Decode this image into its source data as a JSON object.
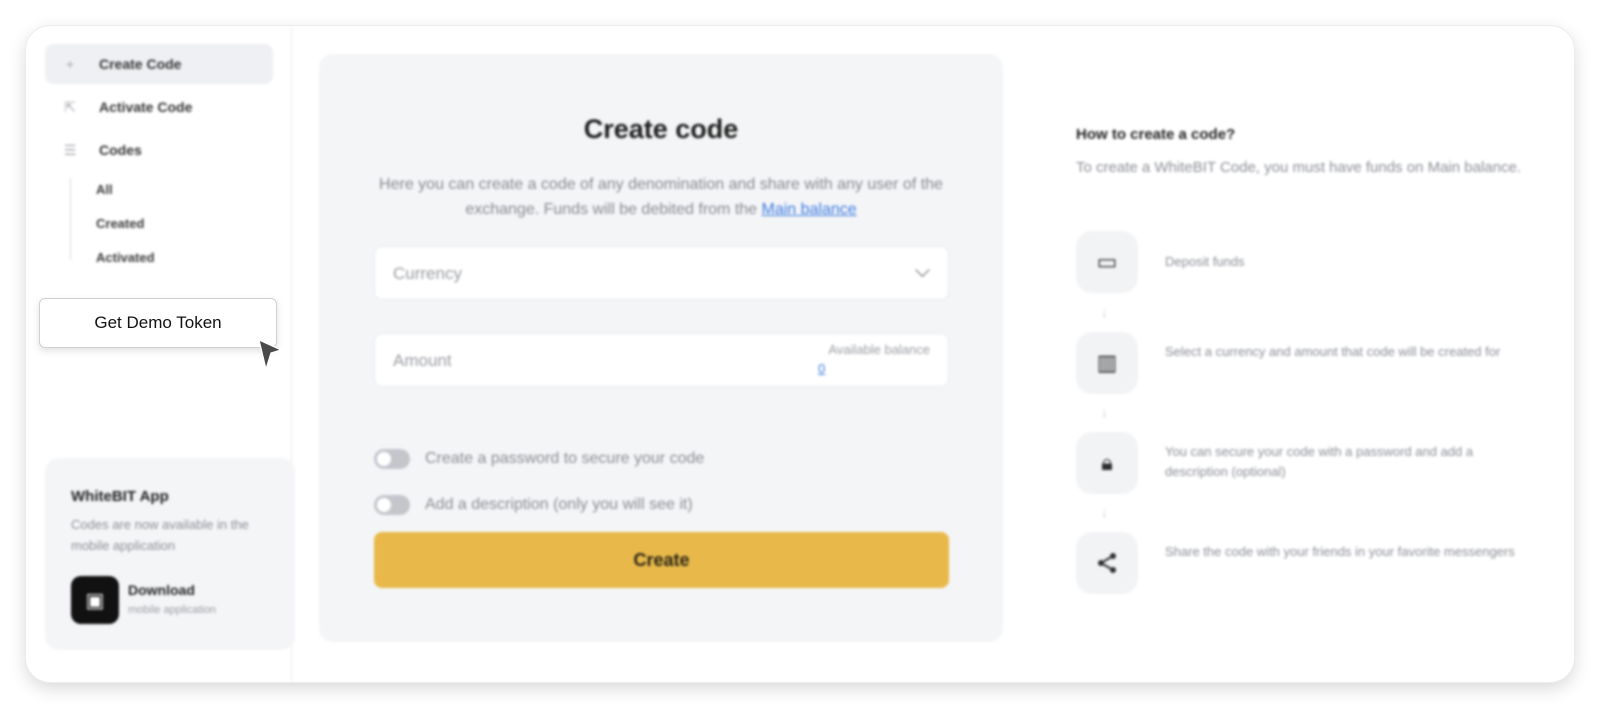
{
  "sidebar": {
    "items": [
      {
        "icon": "plus-icon",
        "label": "Create Code",
        "active": true
      },
      {
        "icon": "activate-icon",
        "label": "Activate Code"
      },
      {
        "icon": "list-icon",
        "label": "Codes"
      }
    ],
    "subitems": [
      "All",
      "Created",
      "Activated"
    ],
    "app_card": {
      "title": "WhiteBIT App",
      "desc": "Codes are now available in the mobile application",
      "download": "Download",
      "download_sub": "mobile application"
    }
  },
  "form": {
    "title": "Create code",
    "desc_part1": "Here you can create a code of any denomination and share with any user of the exchange. Funds will be debited from the ",
    "desc_link": "Main balance",
    "currency_placeholder": "Currency",
    "amount_placeholder": "Amount",
    "balance_label": "Available balance",
    "balance_value": "0",
    "toggle_password": "Create a password to secure your code",
    "toggle_description": "Add a description (only you will see it)",
    "submit_label": "Create"
  },
  "help": {
    "title": "How to create a code?",
    "desc": "To create a WhiteBIT Code, you must have funds on Main balance.",
    "steps": [
      {
        "icon": "wallet-icon",
        "text": "Deposit funds"
      },
      {
        "icon": "coins-icon",
        "text": "Select a currency and amount that code will be created for"
      },
      {
        "icon": "lock-icon",
        "text": "You can secure your code with a password and add a description (optional)"
      },
      {
        "icon": "share-icon",
        "text": "Share the code with your friends in your favorite messengers"
      }
    ]
  },
  "overlay": {
    "demo_button": "Get Demo Token"
  },
  "colors": {
    "accent": "#e8b94a",
    "link": "#3a7be0"
  }
}
